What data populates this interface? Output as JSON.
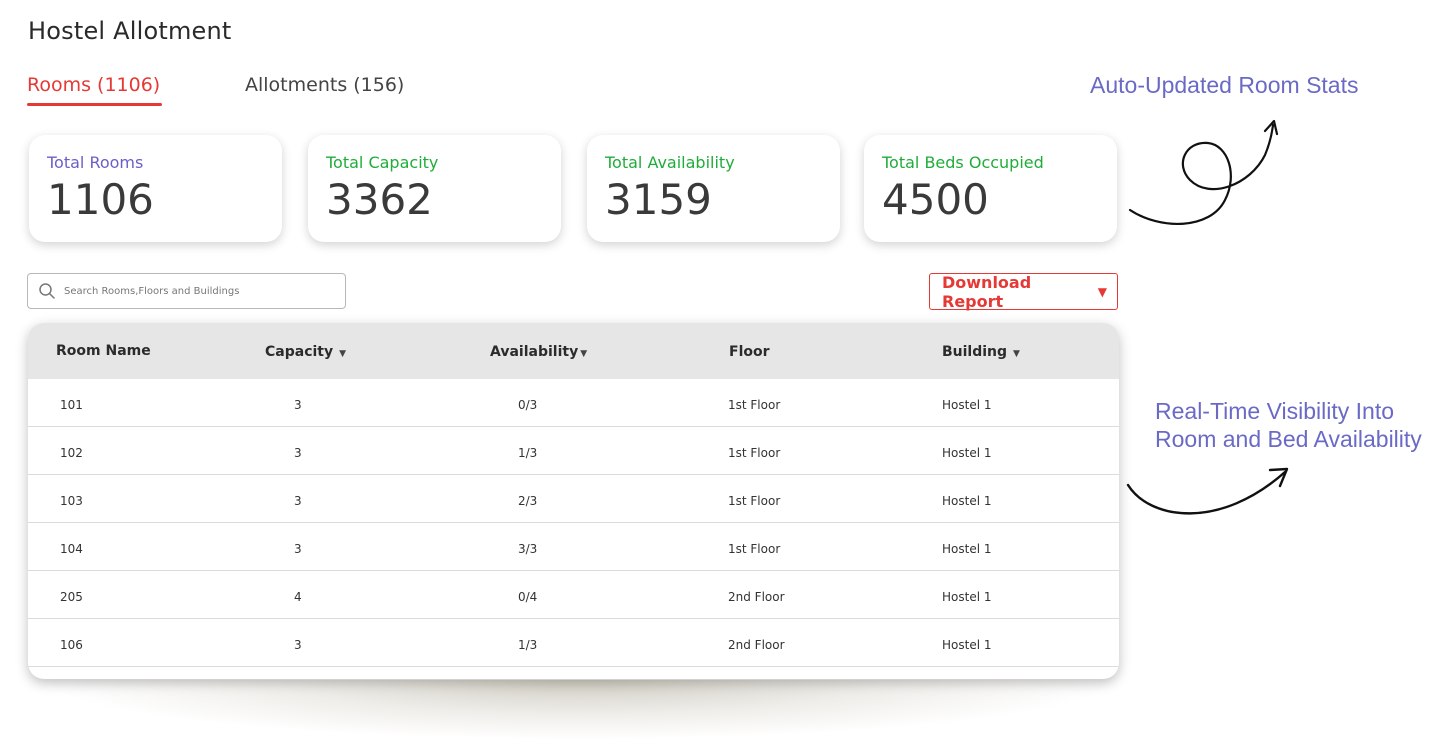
{
  "page": {
    "title": "Hostel Allotment"
  },
  "tabs": [
    {
      "label": "Rooms (1106)",
      "active": true
    },
    {
      "label": "Allotments (156)",
      "active": false
    }
  ],
  "annotations": {
    "note1": "Auto-Updated Room Stats",
    "note2_line1": "Real-Time Visibility Into",
    "note2_line2": "Room and Bed Availability"
  },
  "stats": [
    {
      "label": "Total Rooms",
      "value": "1106",
      "color": "#6a5fc8"
    },
    {
      "label": "Total Capacity",
      "value": "3362",
      "color": "#1fad3a"
    },
    {
      "label": "Total Availability",
      "value": "3159",
      "color": "#1fad3a"
    },
    {
      "label": "Total Beds Occupied",
      "value": "4500",
      "color": "#1fad3a"
    }
  ],
  "search": {
    "placeholder": "Search Rooms,Floors and Buildings",
    "icon": "search-icon"
  },
  "download": {
    "label": "Download Report",
    "icon": "caret-down-icon"
  },
  "table": {
    "columns": [
      {
        "label": "Room Name",
        "sortable": false
      },
      {
        "label": "Capacity",
        "sortable": true
      },
      {
        "label": "Availability",
        "sortable": true
      },
      {
        "label": "Floor",
        "sortable": false
      },
      {
        "label": "Building",
        "sortable": true
      }
    ],
    "rows": [
      [
        "101",
        "3",
        "0/3",
        "1st Floor",
        "Hostel 1"
      ],
      [
        "102",
        "3",
        "1/3",
        "1st Floor",
        "Hostel 1"
      ],
      [
        "103",
        "3",
        "2/3",
        "1st Floor",
        "Hostel 1"
      ],
      [
        "104",
        "3",
        "3/3",
        "1st Floor",
        "Hostel 1"
      ],
      [
        "205",
        "4",
        "0/4",
        "2nd Floor",
        "Hostel 1"
      ],
      [
        "106",
        "3",
        "1/3",
        "2nd Floor",
        "Hostel 1"
      ]
    ]
  },
  "colors": {
    "accent": "#e53935",
    "annotation": "#6a6ac6"
  }
}
